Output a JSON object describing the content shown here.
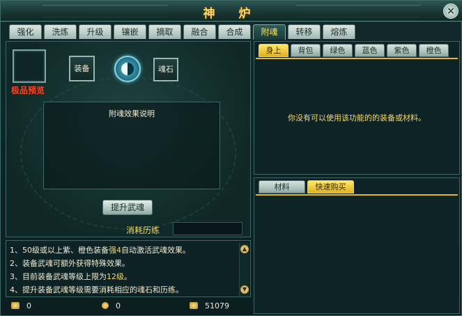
{
  "window": {
    "title": "神 炉"
  },
  "tabs": [
    "强化",
    "洗炼",
    "升级",
    "镶嵌",
    "摘取",
    "融合",
    "合成",
    "附魂",
    "转移",
    "熔炼"
  ],
  "active_tab": "附魂",
  "left": {
    "preview_label": "极品预览",
    "equip_slot": "装备",
    "soulstone_slot": "魂石",
    "desc_title": "附魂效果说明",
    "upgrade_button": "提升武魂",
    "cost_label": "消耗历练"
  },
  "info": {
    "lines": [
      {
        "pre": "1、50级或以上紫、橙色装备",
        "hl": "强4",
        "post": "自动激活武魂效果。"
      },
      {
        "pre": "2、装备武魂可额外获得特殊效果。",
        "hl": "",
        "post": ""
      },
      {
        "pre": "3、目前装备武魂等级上限为",
        "hl": "12级",
        "post": "。"
      },
      {
        "pre": "4、提升装备武魂等级需要消耗相应的魂石和历练。",
        "hl": "",
        "post": ""
      }
    ]
  },
  "currency": {
    "gold": "0",
    "silver": "0",
    "coins": "51079"
  },
  "right": {
    "tabs": [
      "身上",
      "背包",
      "绿色",
      "蓝色",
      "紫色",
      "橙色"
    ],
    "active_tab": "身上",
    "empty_message": "你没有可以使用该功能的的装备或材料。"
  },
  "shop": {
    "tabs": [
      "材料",
      "快速购买"
    ],
    "active_tab": "快速购买"
  },
  "colors": {
    "title": "#f6d96a",
    "accent_tab": "#e0b21e",
    "preview_label": "#f04b2a"
  }
}
